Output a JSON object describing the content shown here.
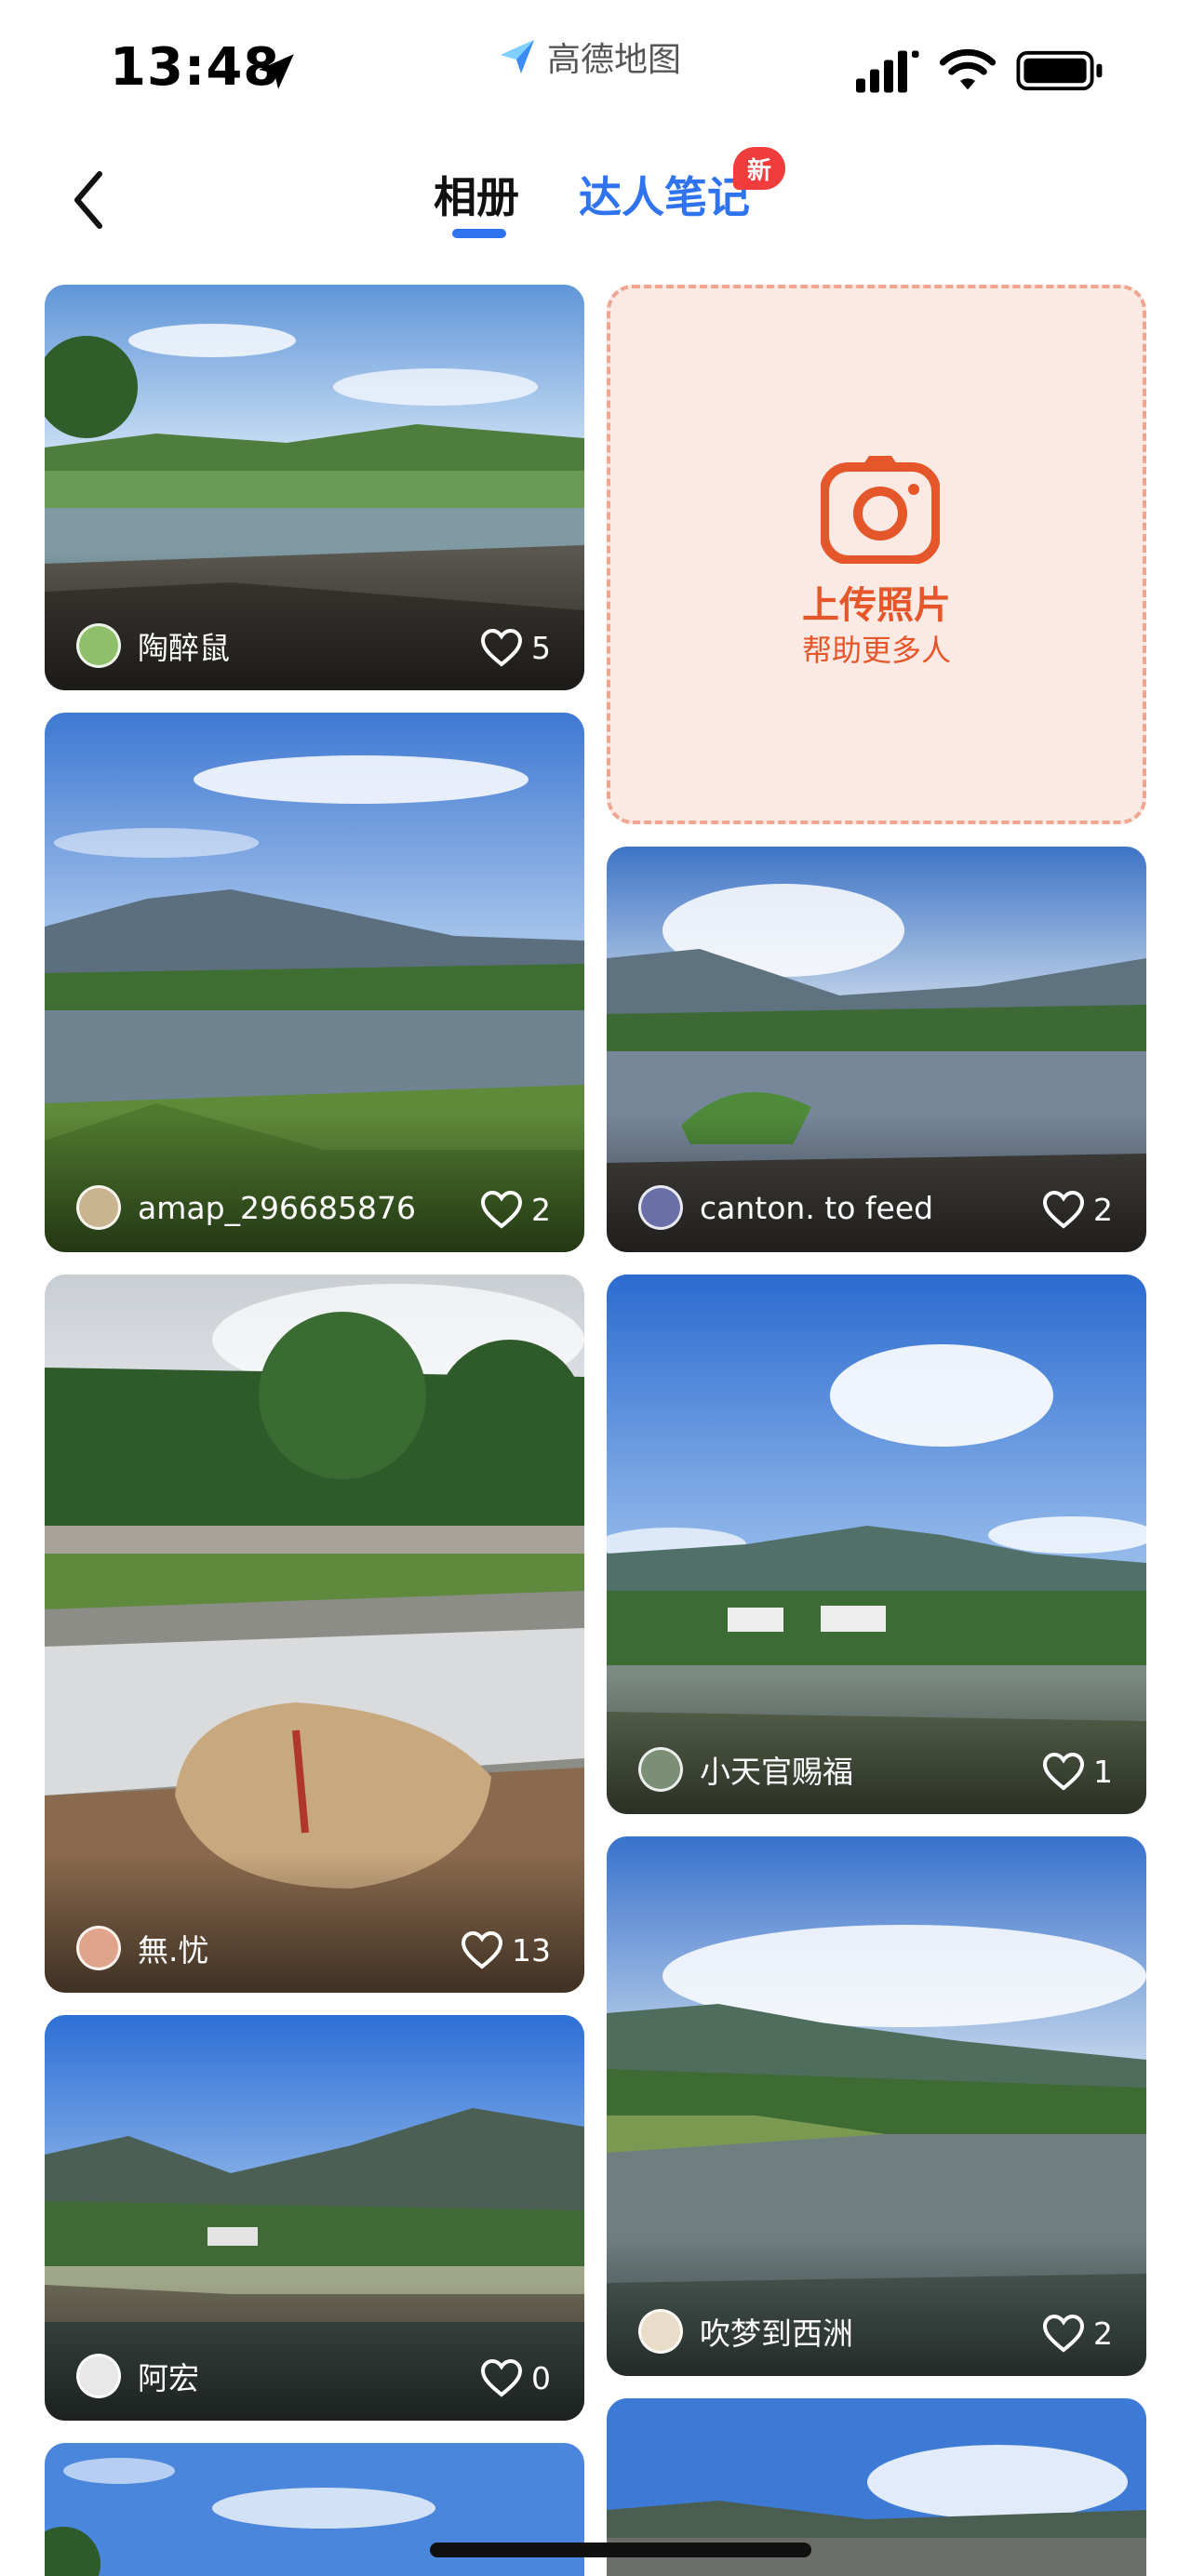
{
  "status_bar": {
    "time": "13:48",
    "app_name": "高德地图"
  },
  "nav": {
    "tabs": [
      {
        "label": "相册",
        "active": true
      },
      {
        "label": "达人笔记",
        "active": false
      }
    ],
    "new_badge": "新"
  },
  "upload": {
    "title": "上传照片",
    "subtitle": "帮助更多人"
  },
  "photos": [
    {
      "author": "陶醉鼠",
      "likes": "5"
    },
    {
      "author": "amap_296685876",
      "likes": "2"
    },
    {
      "author": "canton. to feed",
      "likes": "2"
    },
    {
      "author": "無.忧",
      "likes": "13"
    },
    {
      "author": "小天官赐福",
      "likes": "1"
    },
    {
      "author": "吹梦到西洲",
      "likes": "2"
    },
    {
      "author": "阿宏",
      "likes": "0"
    },
    {
      "author": "",
      "likes": ""
    },
    {
      "author": "",
      "likes": ""
    }
  ],
  "colors": {
    "accent": "#2f74ee",
    "badge": "#f03c3c",
    "upload_bg": "#fbe9e4",
    "upload_text": "#e5562b"
  },
  "icons": [
    "back-chevron-icon",
    "location-arrow-icon",
    "signal-icon",
    "wifi-icon",
    "battery-icon",
    "camera-icon",
    "heart-icon"
  ]
}
